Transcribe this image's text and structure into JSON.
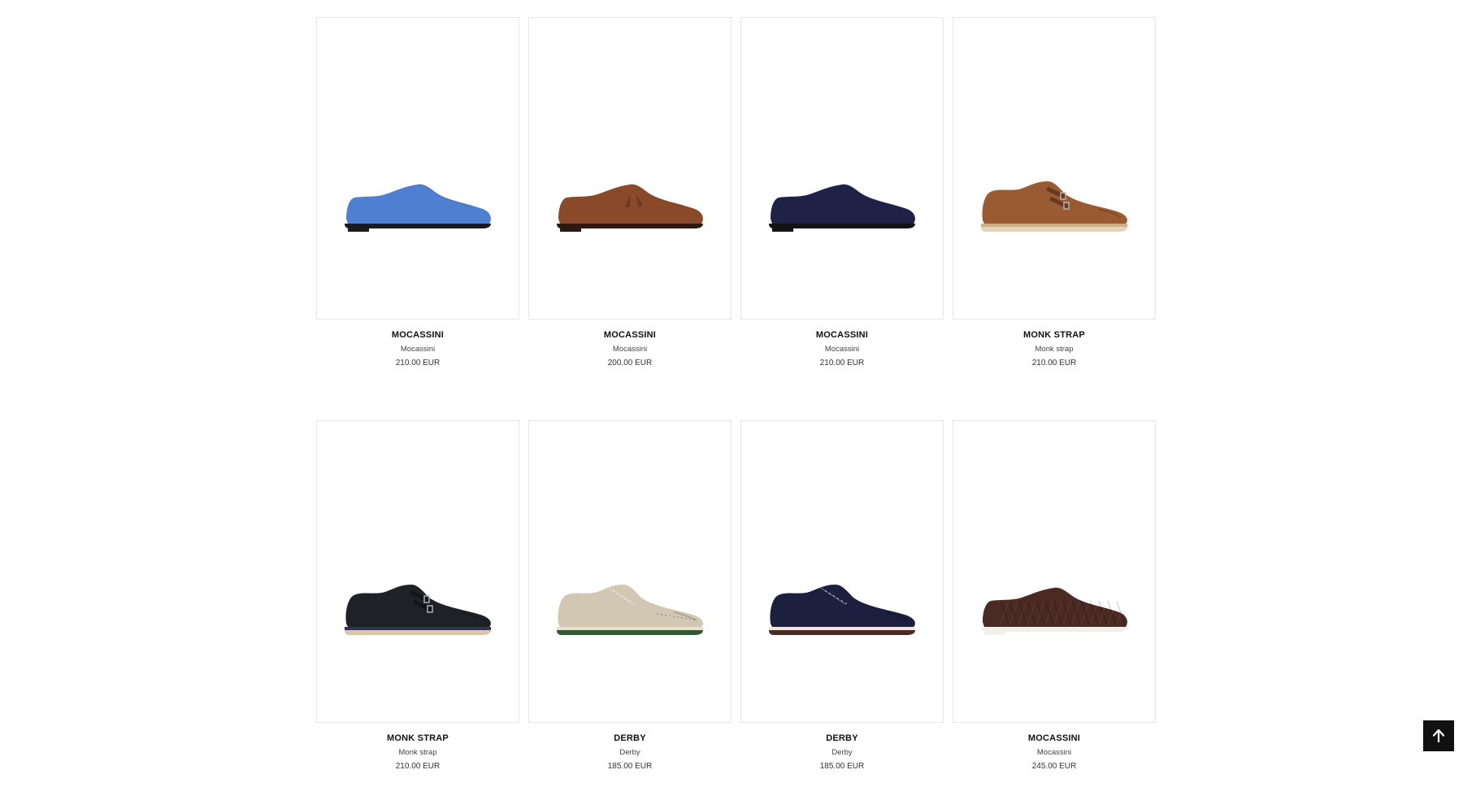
{
  "products": [
    {
      "name": "MOCASSINI",
      "category": "Mocassini",
      "price": "210.00 EUR",
      "style": "loafer",
      "color": "#4f7fd1",
      "sole": "#1b1b1b",
      "sole_accent": "#1b1b1b"
    },
    {
      "name": "MOCASSINI",
      "category": "Mocassini",
      "price": "200.00 EUR",
      "style": "tassel",
      "color": "#8a4a2a",
      "sole": "#2a1a12",
      "sole_accent": "#2a1a12"
    },
    {
      "name": "MOCASSINI",
      "category": "Mocassini",
      "price": "210.00 EUR",
      "style": "loafer",
      "color": "#1f2146",
      "sole": "#141414",
      "sole_accent": "#141414"
    },
    {
      "name": "MONK STRAP",
      "category": "Monk strap",
      "price": "210.00 EUR",
      "style": "monk",
      "color": "#9a5b33",
      "sole": "#e6d3b5",
      "sole_accent": "#c9b08a"
    },
    {
      "name": "MONK STRAP",
      "category": "Monk strap",
      "price": "210.00 EUR",
      "style": "monk",
      "color": "#1e2126",
      "sole": "#d9c7a8",
      "sole_accent": "#2d3553"
    },
    {
      "name": "DERBY",
      "category": "Derby",
      "price": "185.00 EUR",
      "style": "derby",
      "color": "#d2c7b2",
      "sole": "#2f5a34",
      "sole_accent": "#e9e0cf"
    },
    {
      "name": "DERBY",
      "category": "Derby",
      "price": "185.00 EUR",
      "style": "derby",
      "color": "#1c1f3d",
      "sole": "#4a2a23",
      "sole_accent": "#f1e8d8"
    },
    {
      "name": "MOCASSINI",
      "category": "Mocassini",
      "price": "245.00 EUR",
      "style": "woven",
      "color": "#4a2a22",
      "sole": "#f2f0ea",
      "sole_accent": "#f2f0ea"
    }
  ],
  "back_to_top": {
    "icon": "arrow-up-icon"
  }
}
